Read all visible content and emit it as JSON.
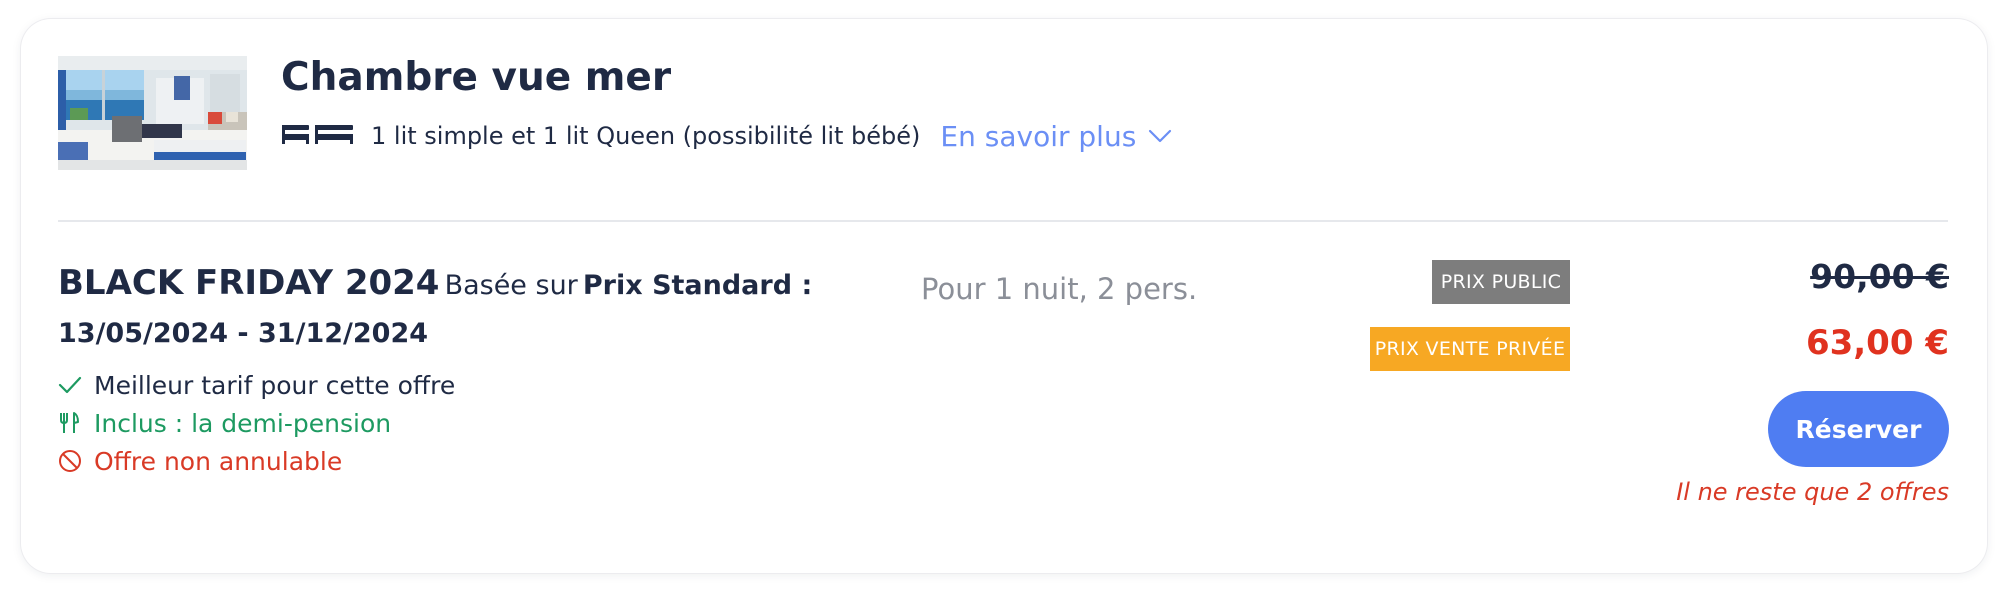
{
  "room": {
    "title": "Chambre vue mer",
    "beds": "1 lit simple et 1 lit Queen (possibilité lit bébé)",
    "more_link": "En savoir plus",
    "icons": [
      "sea-view-room-photo",
      "single-bed-icon",
      "queen-bed-icon",
      "chevron-down-icon"
    ]
  },
  "offer": {
    "name": "BLACK FRIDAY 2024",
    "based_on": "Basée sur",
    "plan": "Prix Standard :",
    "dates": "13/05/2024 - 31/12/2024",
    "features": {
      "best_rate": "Meilleur tarif pour cette offre",
      "meal": "Inclus : la demi-pension",
      "cancellation": "Offre non annulable"
    },
    "occupancy": "Pour 1 nuit, 2 pers."
  },
  "pricing": {
    "public_tag": "PRIX PUBLIC",
    "private_tag": "PRIX VENTE PRIVÉE",
    "public_price": "90,00 €",
    "private_price": "63,00 €",
    "book_label": "Réserver",
    "availability": "Il ne reste que 2 offres"
  },
  "colors": {
    "text": "#1f2a44",
    "link": "#6b8ff5",
    "included": "#1d9a61",
    "warning": "#d93a26",
    "price": "#e0321f",
    "public_tag": "#7d7d7d",
    "private_tag": "#f7a823",
    "button": "#4f7df2"
  }
}
